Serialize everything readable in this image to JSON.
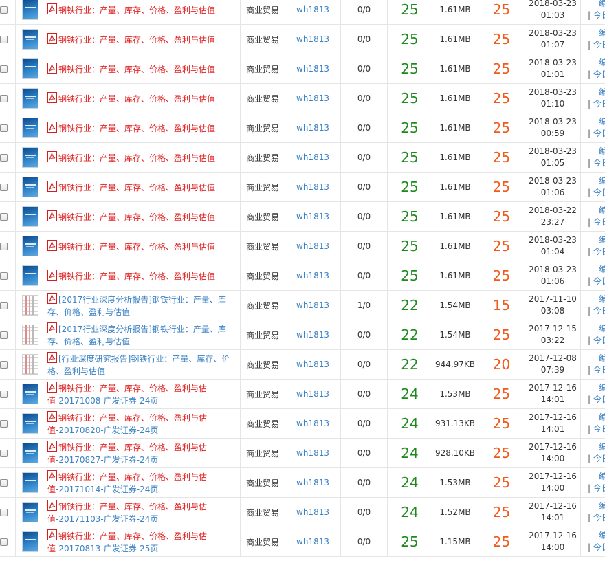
{
  "colors": {
    "title_red": "#e02222",
    "link_blue": "#3c82c4",
    "score_green": "#1e8a1e",
    "price_orange": "#f05a1a"
  },
  "actions": {
    "edit": "编辑",
    "separator": "|",
    "today": "今日"
  },
  "rows": [
    {
      "thumb": "blue-cover",
      "title_red": "钢铁行业：产量、库存、价格、盈利与估值",
      "title_blue": "",
      "category": "商业贸易",
      "user": "wh1813",
      "ratio": "0/0",
      "score": "25",
      "size": "1.61MB",
      "price": "25",
      "date": "2018-03-23",
      "time": "01:03"
    },
    {
      "thumb": "blue-cover",
      "title_red": "钢铁行业：产量、库存、价格、盈利与估值",
      "title_blue": "",
      "category": "商业贸易",
      "user": "wh1813",
      "ratio": "0/0",
      "score": "25",
      "size": "1.61MB",
      "price": "25",
      "date": "2018-03-23",
      "time": "01:07"
    },
    {
      "thumb": "blue-cover",
      "title_red": "钢铁行业：产量、库存、价格、盈利与估值",
      "title_blue": "",
      "category": "商业贸易",
      "user": "wh1813",
      "ratio": "0/0",
      "score": "25",
      "size": "1.61MB",
      "price": "25",
      "date": "2018-03-23",
      "time": "01:01"
    },
    {
      "thumb": "blue-cover",
      "title_red": "钢铁行业：产量、库存、价格、盈利与估值",
      "title_blue": "",
      "category": "商业贸易",
      "user": "wh1813",
      "ratio": "0/0",
      "score": "25",
      "size": "1.61MB",
      "price": "25",
      "date": "2018-03-23",
      "time": "01:10"
    },
    {
      "thumb": "blue-cover",
      "title_red": "钢铁行业：产量、库存、价格、盈利与估值",
      "title_blue": "",
      "category": "商业贸易",
      "user": "wh1813",
      "ratio": "0/0",
      "score": "25",
      "size": "1.61MB",
      "price": "25",
      "date": "2018-03-23",
      "time": "00:59"
    },
    {
      "thumb": "blue-cover",
      "title_red": "钢铁行业：产量、库存、价格、盈利与估值",
      "title_blue": "",
      "category": "商业贸易",
      "user": "wh1813",
      "ratio": "0/0",
      "score": "25",
      "size": "1.61MB",
      "price": "25",
      "date": "2018-03-23",
      "time": "01:05"
    },
    {
      "thumb": "blue-cover",
      "title_red": "钢铁行业：产量、库存、价格、盈利与估值",
      "title_blue": "",
      "category": "商业贸易",
      "user": "wh1813",
      "ratio": "0/0",
      "score": "25",
      "size": "1.61MB",
      "price": "25",
      "date": "2018-03-23",
      "time": "01:06"
    },
    {
      "thumb": "blue-cover",
      "title_red": "钢铁行业：产量、库存、价格、盈利与估值",
      "title_blue": "",
      "category": "商业贸易",
      "user": "wh1813",
      "ratio": "0/0",
      "score": "25",
      "size": "1.61MB",
      "price": "25",
      "date": "2018-03-22",
      "time": "23:27"
    },
    {
      "thumb": "blue-cover",
      "title_red": "钢铁行业：产量、库存、价格、盈利与估值",
      "title_blue": "",
      "category": "商业贸易",
      "user": "wh1813",
      "ratio": "0/0",
      "score": "25",
      "size": "1.61MB",
      "price": "25",
      "date": "2018-03-23",
      "time": "01:04"
    },
    {
      "thumb": "blue-cover",
      "title_red": "钢铁行业：产量、库存、价格、盈利与估值",
      "title_blue": "",
      "category": "商业贸易",
      "user": "wh1813",
      "ratio": "0/0",
      "score": "25",
      "size": "1.61MB",
      "price": "25",
      "date": "2018-03-23",
      "time": "01:06"
    },
    {
      "thumb": "white-cover",
      "title_red": "",
      "title_blue": "[2017行业深度分析报告]钢铁行业：产量、库存、价格、盈利与估值",
      "category": "商业贸易",
      "user": "wh1813",
      "ratio": "1/0",
      "score": "22",
      "size": "1.54MB",
      "price": "15",
      "date": "2017-11-10",
      "time": "03:08"
    },
    {
      "thumb": "white-cover",
      "title_red": "",
      "title_blue": "[2017行业深度分析报告]钢铁行业：产量、库存、价格、盈利与估值",
      "category": "商业贸易",
      "user": "wh1813",
      "ratio": "0/0",
      "score": "22",
      "size": "1.54MB",
      "price": "25",
      "date": "2017-12-15",
      "time": "03:22"
    },
    {
      "thumb": "white-cover",
      "title_red": "",
      "title_blue": "[行业深度研究报告]钢铁行业：产量、库存、价格、盈利与估值",
      "category": "商业贸易",
      "user": "wh1813",
      "ratio": "0/0",
      "score": "22",
      "size": "944.97KB",
      "price": "20",
      "date": "2017-12-08",
      "time": "07:39"
    },
    {
      "thumb": "blue-cover",
      "title_red": "钢铁行业：产量、库存、价格、盈利与估值",
      "title_blue": "-20171008-广发证券-24页",
      "category": "商业贸易",
      "user": "wh1813",
      "ratio": "0/0",
      "score": "24",
      "size": "1.53MB",
      "price": "25",
      "date": "2017-12-16",
      "time": "14:01"
    },
    {
      "thumb": "blue-cover",
      "title_red": "钢铁行业：产量、库存、价格、盈利与估值",
      "title_blue": "-20170820-广发证券-24页",
      "category": "商业贸易",
      "user": "wh1813",
      "ratio": "0/0",
      "score": "24",
      "size": "931.13KB",
      "price": "25",
      "date": "2017-12-16",
      "time": "14:01"
    },
    {
      "thumb": "blue-cover",
      "title_red": "钢铁行业：产量、库存、价格、盈利与估值",
      "title_blue": "-20170827-广发证券-24页",
      "category": "商业贸易",
      "user": "wh1813",
      "ratio": "0/0",
      "score": "24",
      "size": "928.10KB",
      "price": "25",
      "date": "2017-12-16",
      "time": "14:00"
    },
    {
      "thumb": "blue-cover",
      "title_red": "钢铁行业：产量、库存、价格、盈利与估值",
      "title_blue": "-20171014-广发证券-24页",
      "category": "商业贸易",
      "user": "wh1813",
      "ratio": "0/0",
      "score": "24",
      "size": "1.53MB",
      "price": "25",
      "date": "2017-12-16",
      "time": "14:00"
    },
    {
      "thumb": "blue-cover",
      "title_red": "钢铁行业：产量、库存、价格、盈利与估值",
      "title_blue": "-20171103-广发证券-24页",
      "category": "商业贸易",
      "user": "wh1813",
      "ratio": "0/0",
      "score": "24",
      "size": "1.52MB",
      "price": "25",
      "date": "2017-12-16",
      "time": "14:01"
    },
    {
      "thumb": "blue-cover",
      "title_red": "钢铁行业：产量、库存、价格、盈利与估值",
      "title_blue": "-20170813-广发证券-25页",
      "category": "商业贸易",
      "user": "wh1813",
      "ratio": "0/0",
      "score": "25",
      "size": "1.15MB",
      "price": "25",
      "date": "2017-12-16",
      "time": "14:00"
    }
  ]
}
